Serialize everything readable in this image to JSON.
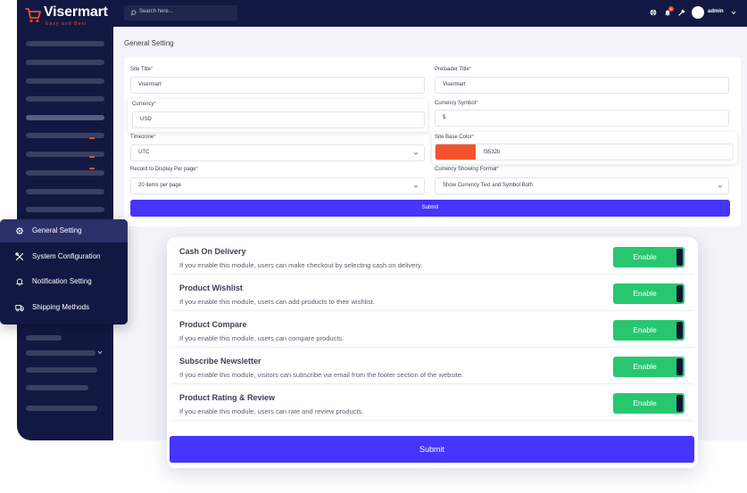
{
  "brand": {
    "name": "Visermart",
    "tagline": "Easy and Best",
    "accent_color": "#f04c23",
    "primary_color": "#4634ff",
    "sidebar_color": "#131842"
  },
  "header": {
    "search_placeholder": "Search here...",
    "icons": [
      "globe-icon",
      "bell-icon",
      "wrench-icon"
    ],
    "notification_count": "9+",
    "user_name": "admin"
  },
  "page": {
    "title": "General Setting"
  },
  "form": {
    "site_title": {
      "label": "Site Title",
      "value": "Visermart"
    },
    "preloader_title": {
      "label": "Preloader Title",
      "value": "Visermart"
    },
    "currency": {
      "label": "Currency",
      "value": "USD"
    },
    "currency_symbol": {
      "label": "Currency Symbol",
      "value": "$"
    },
    "timezone": {
      "label": "Timezone",
      "value": "UTC"
    },
    "site_base_color": {
      "label": "Site Base Color",
      "value": "f3532b",
      "swatch": "#f3532b"
    },
    "records_per_page": {
      "label": "Record to Display Per page",
      "value": "20 items per page"
    },
    "currency_format": {
      "label": "Currency Showing Format",
      "value": "Show Currency Text and Symbol Both"
    },
    "required_mark": "*",
    "submit_label": "Submit"
  },
  "menu": {
    "items": [
      {
        "label": "General Setting",
        "icon": "gear-icon",
        "active": true
      },
      {
        "label": "System Configuration",
        "icon": "tools-icon",
        "active": false
      },
      {
        "label": "Notification Setting",
        "icon": "bell-icon",
        "active": false
      },
      {
        "label": "Shipping Methods",
        "icon": "truck-icon",
        "active": false
      }
    ]
  },
  "modules": {
    "items": [
      {
        "title": "Cash On Delivery",
        "description": "If you enable this module, users can make checkout by selecting cash on delivery.",
        "toggle_label": "Enable"
      },
      {
        "title": "Product Wishlist",
        "description": "If you enable this module, users can add products to their wishlist.",
        "toggle_label": "Enable"
      },
      {
        "title": "Product Compare",
        "description": "If you enable this module, users can compare products.",
        "toggle_label": "Enable"
      },
      {
        "title": "Subscribe Newsletter",
        "description": "If you enable this module, visitors can subscribe via email from the footer section of the website.",
        "toggle_label": "Enable"
      },
      {
        "title": "Product Rating & Review",
        "description": "If you enable this module, users can rate and review products.",
        "toggle_label": "Enable"
      }
    ],
    "toggle_color": "#28c76f",
    "submit_label": "Submit"
  }
}
